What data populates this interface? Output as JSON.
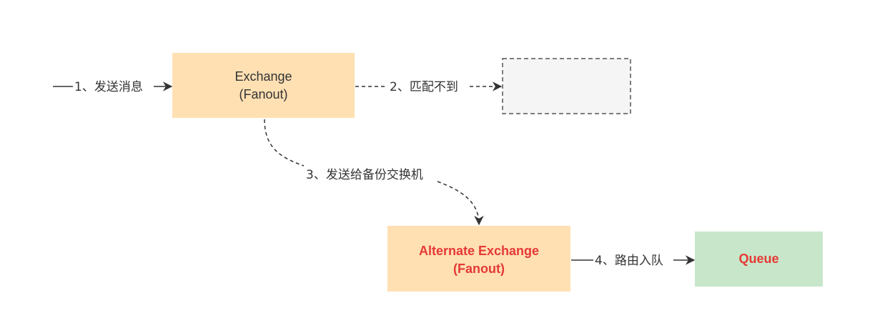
{
  "colors": {
    "exchange_fill": "#FFE0B3",
    "unmatched_fill": "#F5F5F5",
    "unmatched_stroke": "#555555",
    "queue_fill": "#C8E6C9",
    "highlight_text": "#E53935",
    "line": "#333333",
    "text": "#333333"
  },
  "nodes": {
    "exchange": {
      "line1": "Exchange",
      "line2": "(Fanout)"
    },
    "unmatched": {
      "label": ""
    },
    "alternate_exchange": {
      "line1": "Alternate Exchange",
      "line2": "(Fanout)"
    },
    "queue": {
      "label": "Queue"
    }
  },
  "edges": {
    "send_message": {
      "label": "1、发送消息",
      "style": "solid"
    },
    "no_match": {
      "label": "2、匹配不到",
      "style": "dashed"
    },
    "to_alternate": {
      "label": "3、发送给备份交换机",
      "style": "dashed"
    },
    "route_to_queue": {
      "label": "4、路由入队",
      "style": "solid"
    }
  }
}
